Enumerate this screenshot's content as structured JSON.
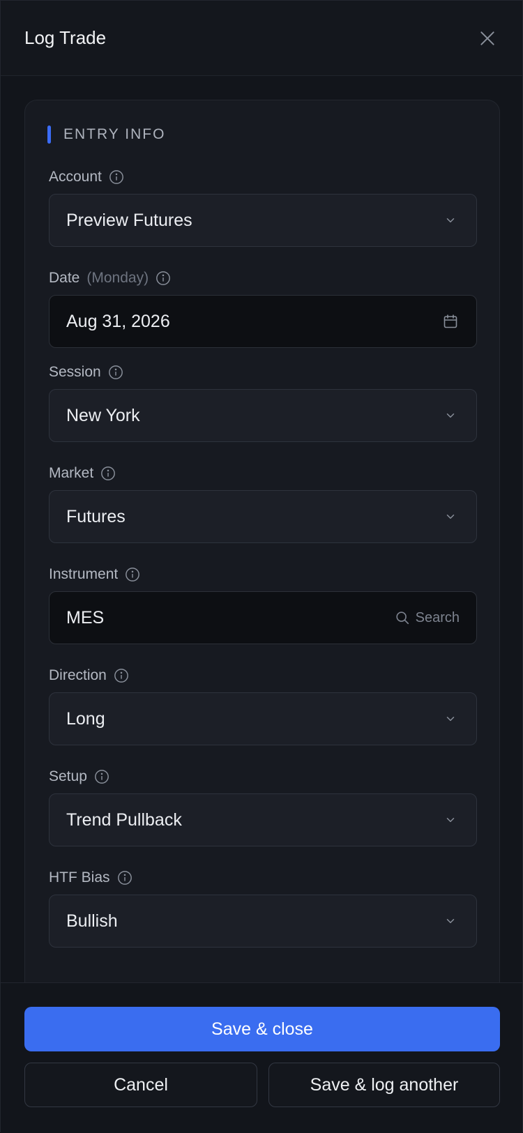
{
  "header": {
    "title": "Log Trade"
  },
  "section": {
    "title": "ENTRY INFO"
  },
  "fields": {
    "account": {
      "label": "Account",
      "value": "Preview Futures"
    },
    "date": {
      "label": "Date",
      "sublabel": "(Monday)",
      "value": "Aug 31, 2026"
    },
    "session": {
      "label": "Session",
      "value": "New York"
    },
    "market": {
      "label": "Market",
      "value": "Futures"
    },
    "instrument": {
      "label": "Instrument",
      "value": "MES",
      "search_hint": "Search"
    },
    "direction": {
      "label": "Direction",
      "value": "Long"
    },
    "setup": {
      "label": "Setup",
      "value": "Trend Pullback"
    },
    "htf_bias": {
      "label": "HTF Bias",
      "value": "Bullish"
    }
  },
  "footer": {
    "save_close": "Save & close",
    "cancel": "Cancel",
    "save_another": "Save & log another"
  },
  "colors": {
    "accent": "#3b6cf6",
    "primary_button": "#3a6df0"
  }
}
